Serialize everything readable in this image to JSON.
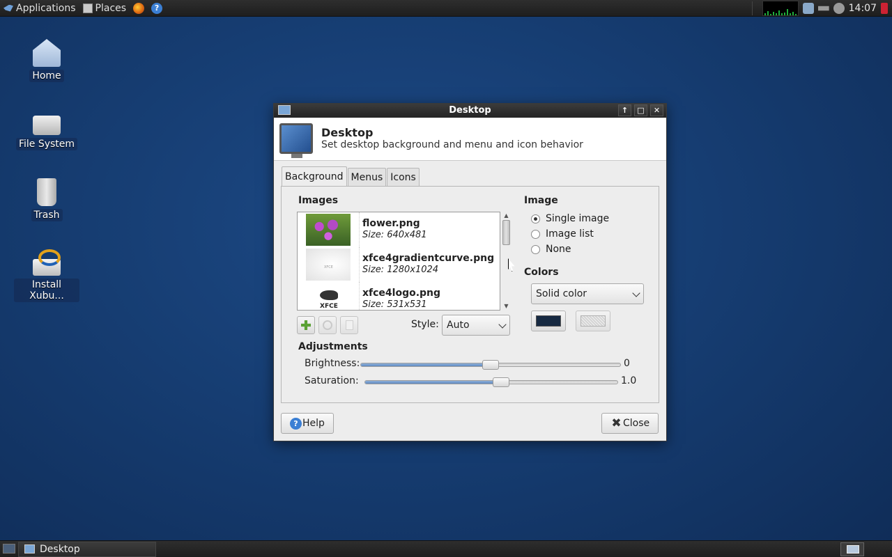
{
  "top_panel": {
    "applications_label": "Applications",
    "places_label": "Places",
    "clock": "14:07"
  },
  "desktop_icons": [
    {
      "label": "Home",
      "icon": "home-folder-icon"
    },
    {
      "label": "File System",
      "icon": "drive-icon"
    },
    {
      "label": "Trash",
      "icon": "trash-icon"
    },
    {
      "label": "Install Xubu...",
      "icon": "installer-icon"
    }
  ],
  "dialog": {
    "window_title": "Desktop",
    "header_title": "Desktop",
    "header_subtitle": "Set desktop background and menu and icon behavior",
    "tabs": [
      {
        "label": "Background",
        "active": true
      },
      {
        "label": "Menus",
        "active": false
      },
      {
        "label": "Icons",
        "active": false
      }
    ],
    "images": {
      "heading": "Images",
      "items": [
        {
          "name": "flower.png",
          "size": "Size: 640x481"
        },
        {
          "name": "xfce4gradientcurve.png",
          "size": "Size: 1280x1024"
        },
        {
          "name": "xfce4logo.png",
          "size": "Size: 531x531"
        }
      ],
      "style_label": "Style:",
      "style_value": "Auto"
    },
    "image_mode": {
      "heading": "Image",
      "options": [
        {
          "label": "Single image",
          "checked": true
        },
        {
          "label": "Image list",
          "checked": false
        },
        {
          "label": "None",
          "checked": false
        }
      ]
    },
    "colors": {
      "heading": "Colors",
      "mode": "Solid color",
      "primary_color": "#172a42"
    },
    "adjustments": {
      "heading": "Adjustments",
      "brightness_label": "Brightness:",
      "brightness_value": "0",
      "brightness_position": 0.5,
      "saturation_label": "Saturation:",
      "saturation_value": "1.0",
      "saturation_position": 0.54
    },
    "buttons": {
      "help": "Help",
      "close": "Close"
    }
  },
  "taskbar": {
    "task_label": "Desktop"
  }
}
